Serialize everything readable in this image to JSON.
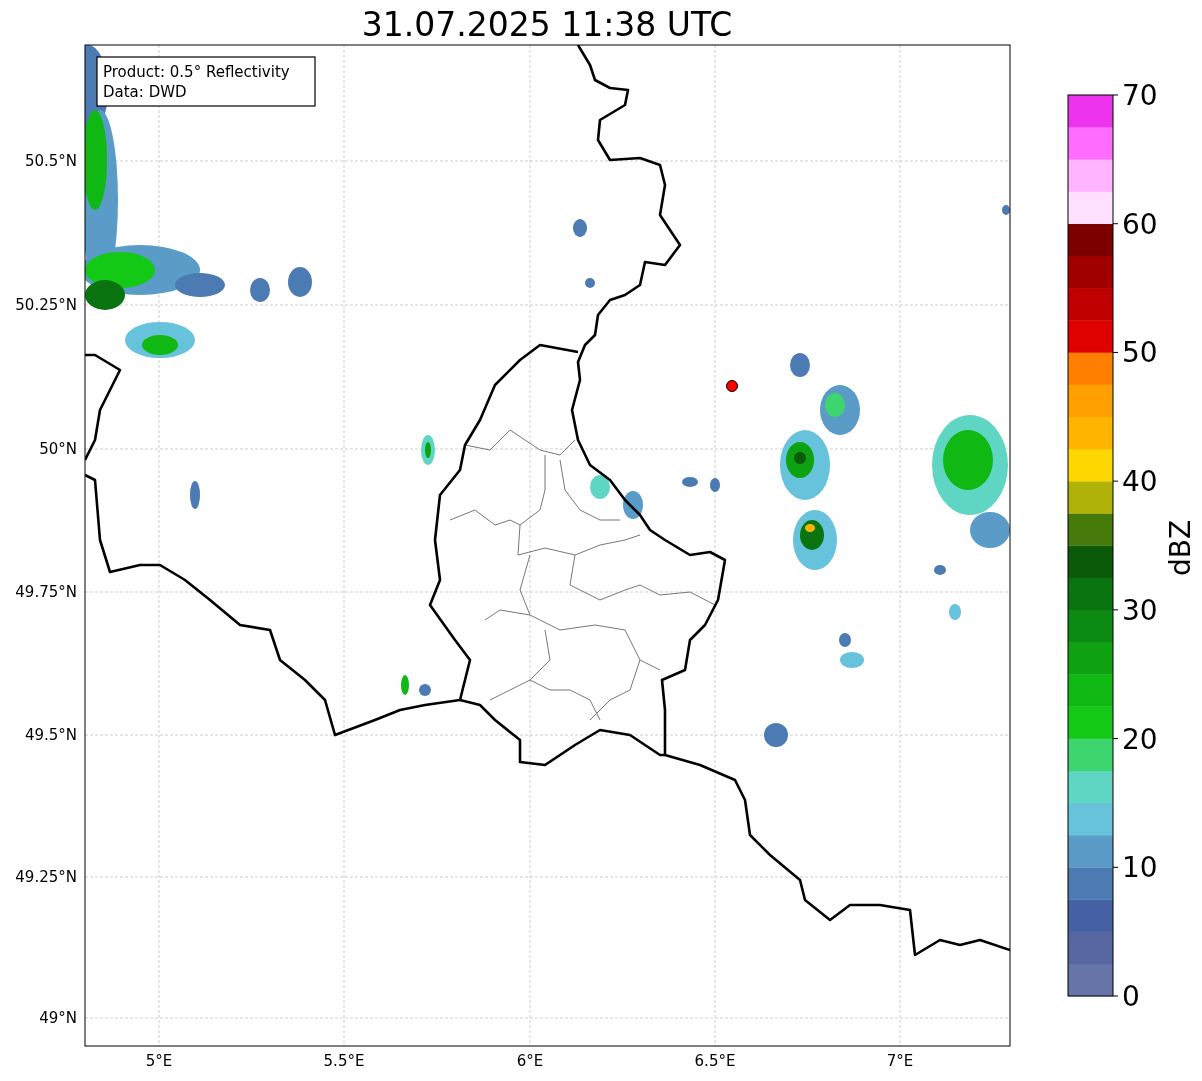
{
  "title": "31.07.2025 11:38 UTC",
  "info_box": {
    "lines": [
      "Product: 0.5° Reflectivity",
      "Data: DWD"
    ]
  },
  "x_ticks": [
    "5°E",
    "5.5°E",
    "6°E",
    "6.5°E",
    "7°E"
  ],
  "y_ticks": [
    "50.5°N",
    "50.25°N",
    "50°N",
    "49.75°N",
    "49.5°N",
    "49.25°N",
    "49°N"
  ],
  "colorbar": {
    "label": "dBZ",
    "ticks": [
      "70",
      "60",
      "50",
      "40",
      "30",
      "20",
      "10",
      "0"
    ],
    "segments": [
      {
        "color": "#6674a8"
      },
      {
        "color": "#5566a0"
      },
      {
        "color": "#4560a3"
      },
      {
        "color": "#4c7bb4"
      },
      {
        "color": "#5a9cc7"
      },
      {
        "color": "#67c2dc"
      },
      {
        "color": "#5fd6c3"
      },
      {
        "color": "#3dd56e"
      },
      {
        "color": "#13c916"
      },
      {
        "color": "#10b814"
      },
      {
        "color": "#0ea213"
      },
      {
        "color": "#0c8a12"
      },
      {
        "color": "#0a7510"
      },
      {
        "color": "#0a5a0a"
      },
      {
        "color": "#467a0b"
      },
      {
        "color": "#b0b20a"
      },
      {
        "color": "#ffd700"
      },
      {
        "color": "#ffb400"
      },
      {
        "color": "#ff9f00"
      },
      {
        "color": "#ff8000"
      },
      {
        "color": "#e00000"
      },
      {
        "color": "#c00000"
      },
      {
        "color": "#a00000"
      },
      {
        "color": "#7d0000"
      },
      {
        "color": "#ffe0ff"
      },
      {
        "color": "#ffb4ff"
      },
      {
        "color": "#ff6cff"
      },
      {
        "color": "#ee33ee"
      }
    ]
  }
}
